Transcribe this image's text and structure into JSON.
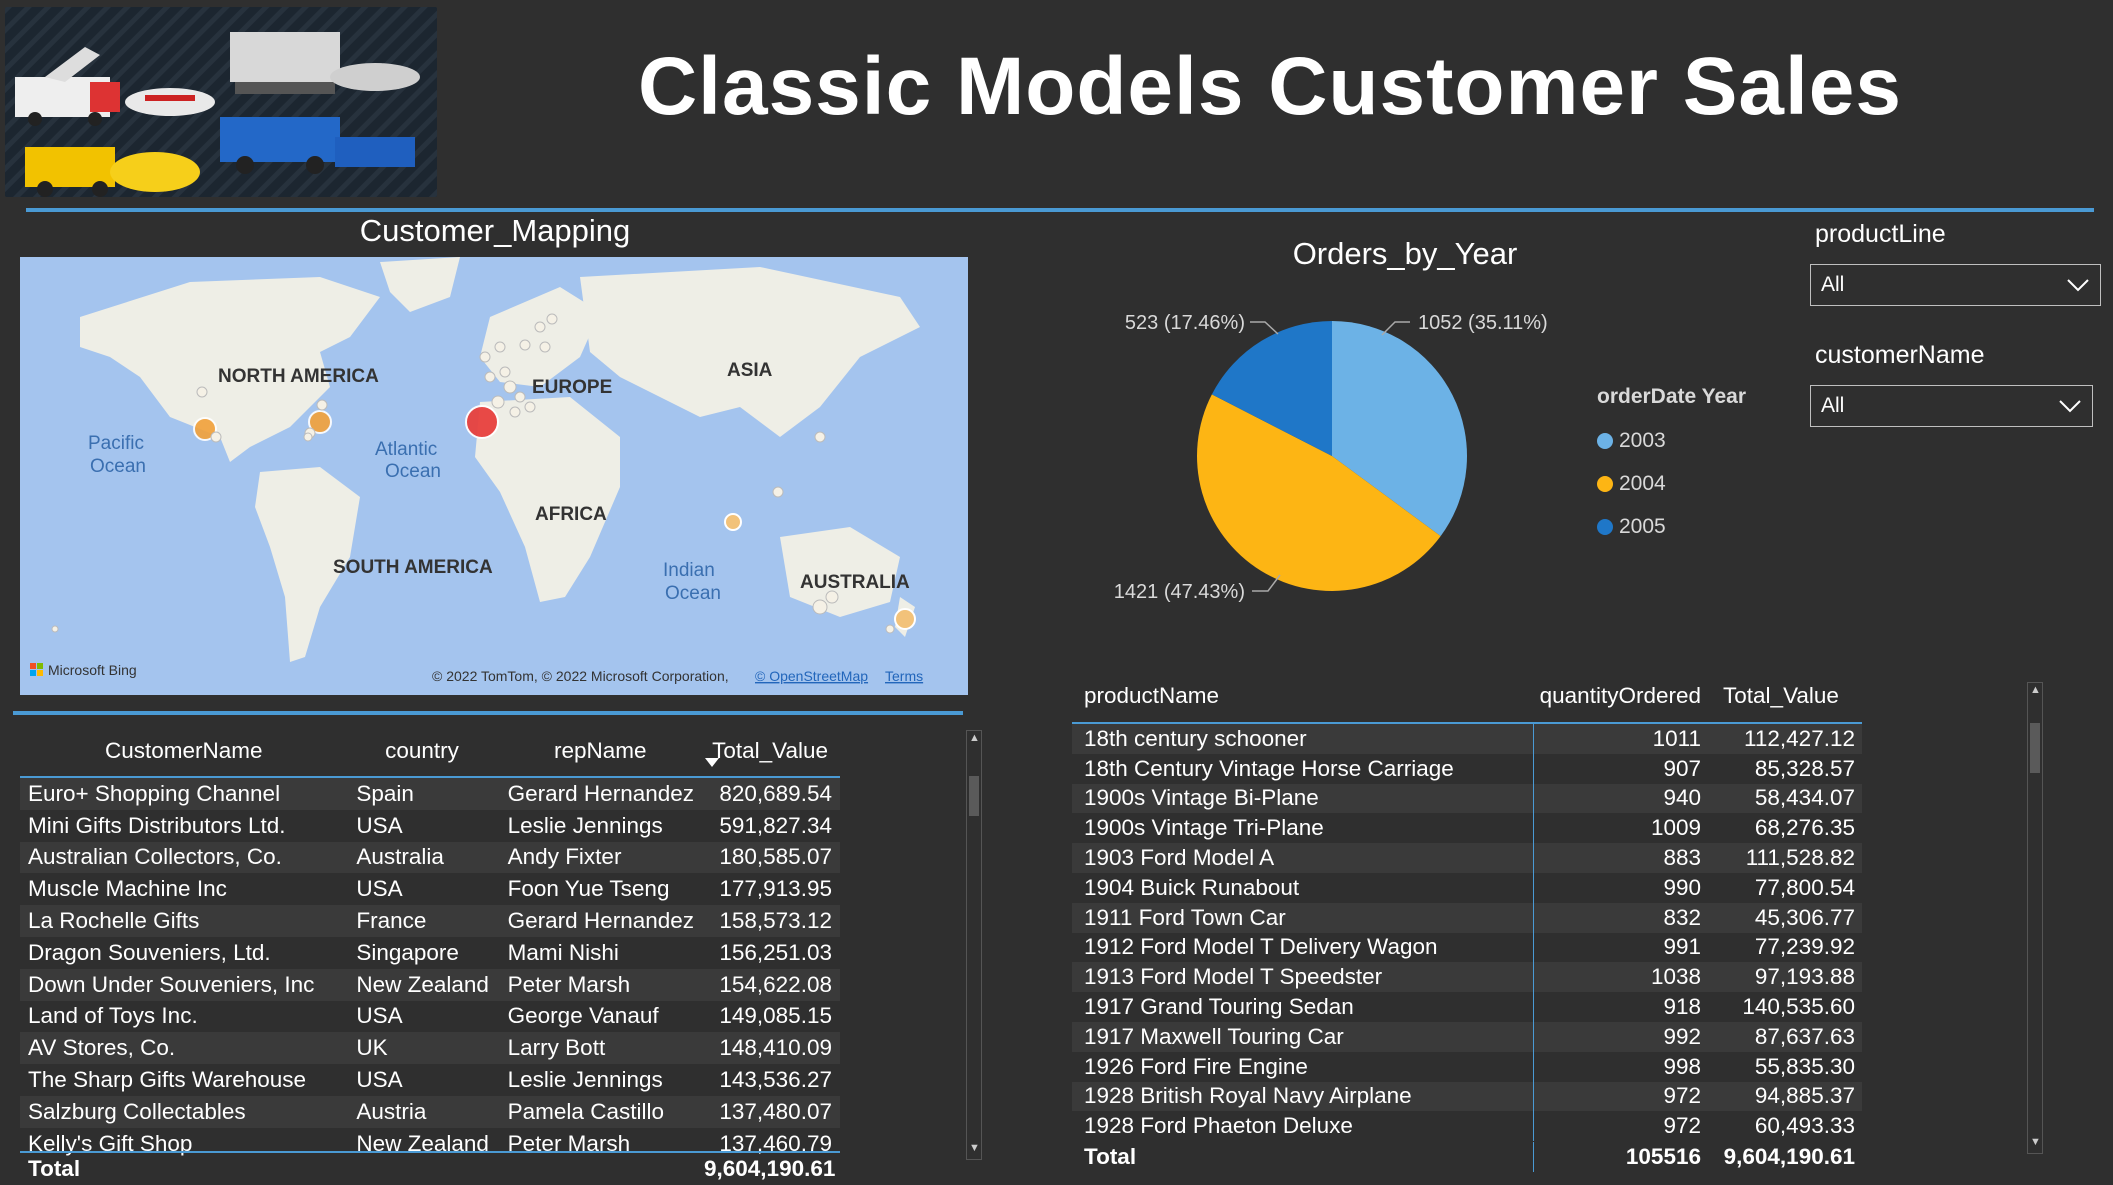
{
  "header": {
    "title": "Classic Models Customer Sales"
  },
  "map": {
    "title": "Customer_Mapping",
    "continents": [
      "NORTH AMERICA",
      "EUROPE",
      "ASIA",
      "AFRICA",
      "SOUTH AMERICA",
      "AUSTRALIA"
    ],
    "oceans": {
      "pacific": [
        "Pacific",
        "Ocean"
      ],
      "atlantic": [
        "Atlantic",
        "Ocean"
      ],
      "indian": [
        "Indian",
        "Ocean"
      ]
    },
    "bing": "Microsoft Bing",
    "attribution": "© 2022 TomTom, © 2022 Microsoft Corporation,",
    "osm": "© OpenStreetMap",
    "terms": "Terms"
  },
  "customers": {
    "headers": {
      "name": "CustomerName",
      "country": "country",
      "rep": "repName",
      "value": "Total_Value"
    },
    "rows": [
      {
        "name": "Euro+ Shopping Channel",
        "country": "Spain",
        "rep": "Gerard Hernandez",
        "value": "820,689.54"
      },
      {
        "name": "Mini Gifts Distributors Ltd.",
        "country": "USA",
        "rep": "Leslie Jennings",
        "value": "591,827.34"
      },
      {
        "name": "Australian Collectors, Co.",
        "country": "Australia",
        "rep": "Andy Fixter",
        "value": "180,585.07"
      },
      {
        "name": "Muscle Machine Inc",
        "country": "USA",
        "rep": "Foon Yue Tseng",
        "value": "177,913.95"
      },
      {
        "name": "La Rochelle Gifts",
        "country": "France",
        "rep": "Gerard Hernandez",
        "value": "158,573.12"
      },
      {
        "name": "Dragon Souveniers, Ltd.",
        "country": "Singapore",
        "rep": "Mami Nishi",
        "value": "156,251.03"
      },
      {
        "name": "Down Under Souveniers, Inc",
        "country": "New Zealand",
        "rep": "Peter Marsh",
        "value": "154,622.08"
      },
      {
        "name": "Land of Toys Inc.",
        "country": "USA",
        "rep": "George Vanauf",
        "value": "149,085.15"
      },
      {
        "name": "AV Stores, Co.",
        "country": "UK",
        "rep": "Larry Bott",
        "value": "148,410.09"
      },
      {
        "name": "The Sharp Gifts Warehouse",
        "country": "USA",
        "rep": "Leslie Jennings",
        "value": "143,536.27"
      },
      {
        "name": "Salzburg Collectables",
        "country": "Austria",
        "rep": "Pamela Castillo",
        "value": "137,480.07"
      },
      {
        "name": "Kelly's Gift Shop",
        "country": "New Zealand",
        "rep": "Peter Marsh",
        "value": "137,460.79"
      }
    ],
    "total_label": "Total",
    "total_value": "9,604,190.61"
  },
  "pie": {
    "title": "Orders_by_Year",
    "legend_title": "orderDate Year",
    "label_2003": "1052 (35.11%)",
    "label_2004": "1421 (47.43%)",
    "label_2005": "523 (17.46%)"
  },
  "chart_data": {
    "type": "pie",
    "title": "Orders_by_Year",
    "legend_title": "orderDate Year",
    "legend_position": "right",
    "categories": [
      "2003",
      "2004",
      "2005"
    ],
    "values": [
      1052,
      1421,
      523
    ],
    "percentages": [
      35.11,
      47.43,
      17.46
    ],
    "colors": [
      "#6cb2e6",
      "#fdb514",
      "#1f77c8"
    ]
  },
  "slicers": {
    "product_line": {
      "label": "productLine",
      "value": "All"
    },
    "customer_name": {
      "label": "customerName",
      "value": "All"
    }
  },
  "products": {
    "headers": {
      "name": "productName",
      "qty": "quantityOrdered",
      "value": "Total_Value"
    },
    "rows": [
      {
        "name": "18th century schooner",
        "qty": "1011",
        "value": "112,427.12"
      },
      {
        "name": "18th Century Vintage Horse Carriage",
        "qty": "907",
        "value": "85,328.57"
      },
      {
        "name": "1900s Vintage Bi-Plane",
        "qty": "940",
        "value": "58,434.07"
      },
      {
        "name": "1900s Vintage Tri-Plane",
        "qty": "1009",
        "value": "68,276.35"
      },
      {
        "name": "1903 Ford Model A",
        "qty": "883",
        "value": "111,528.82"
      },
      {
        "name": "1904 Buick Runabout",
        "qty": "990",
        "value": "77,800.54"
      },
      {
        "name": "1911 Ford Town Car",
        "qty": "832",
        "value": "45,306.77"
      },
      {
        "name": "1912 Ford Model T Delivery Wagon",
        "qty": "991",
        "value": "77,239.92"
      },
      {
        "name": "1913 Ford Model T Speedster",
        "qty": "1038",
        "value": "97,193.88"
      },
      {
        "name": "1917 Grand Touring Sedan",
        "qty": "918",
        "value": "140,535.60"
      },
      {
        "name": "1917 Maxwell Touring Car",
        "qty": "992",
        "value": "87,637.63"
      },
      {
        "name": "1926 Ford Fire Engine",
        "qty": "998",
        "value": "55,835.30"
      },
      {
        "name": "1928 British Royal Navy Airplane",
        "qty": "972",
        "value": "94,885.37"
      },
      {
        "name": "1928 Ford Phaeton Deluxe",
        "qty": "972",
        "value": "60,493.33"
      }
    ],
    "total_label": "Total",
    "total_qty": "105516",
    "total_value": "9,604,190.61"
  }
}
